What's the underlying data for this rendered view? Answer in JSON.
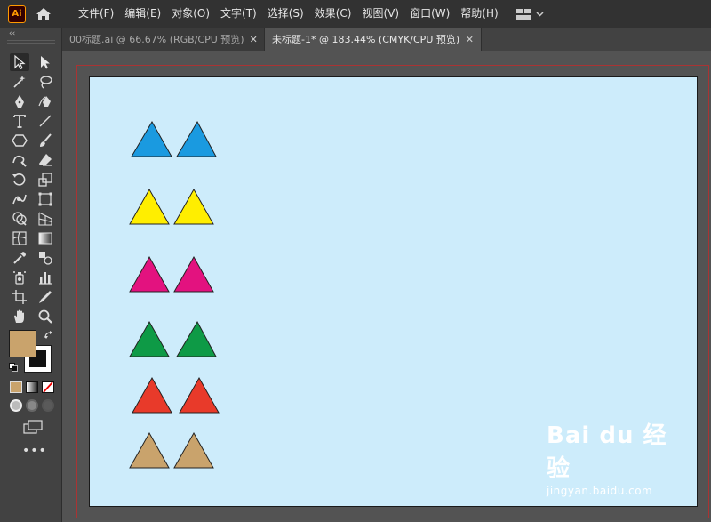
{
  "app": {
    "logo_text": "Ai",
    "menus": [
      "文件(F)",
      "编辑(E)",
      "对象(O)",
      "文字(T)",
      "选择(S)",
      "效果(C)",
      "视图(V)",
      "窗口(W)",
      "帮助(H)"
    ]
  },
  "tabs": [
    {
      "title": "00标题.ai @ 66.67% (RGB/CPU 预览)",
      "active": false
    },
    {
      "title": "未标题-1* @ 183.44% (CMYK/CPU 预览)",
      "active": true
    }
  ],
  "toolbar": {
    "collapse_glyph": "‹‹",
    "fill_color": "#c9a36c",
    "stroke_color": "#111111",
    "more": "•••"
  },
  "artboard": {
    "background": "#cdecfb",
    "rows": [
      {
        "color": "#1a9ae0"
      },
      {
        "color": "#ffee00"
      },
      {
        "color": "#e3127f"
      },
      {
        "color": "#0e9a46"
      },
      {
        "color": "#e83a2a"
      },
      {
        "color": "#c9a36c"
      }
    ]
  },
  "watermark": {
    "logo": "Bai du 经验",
    "url": "jingyan.baidu.com"
  }
}
